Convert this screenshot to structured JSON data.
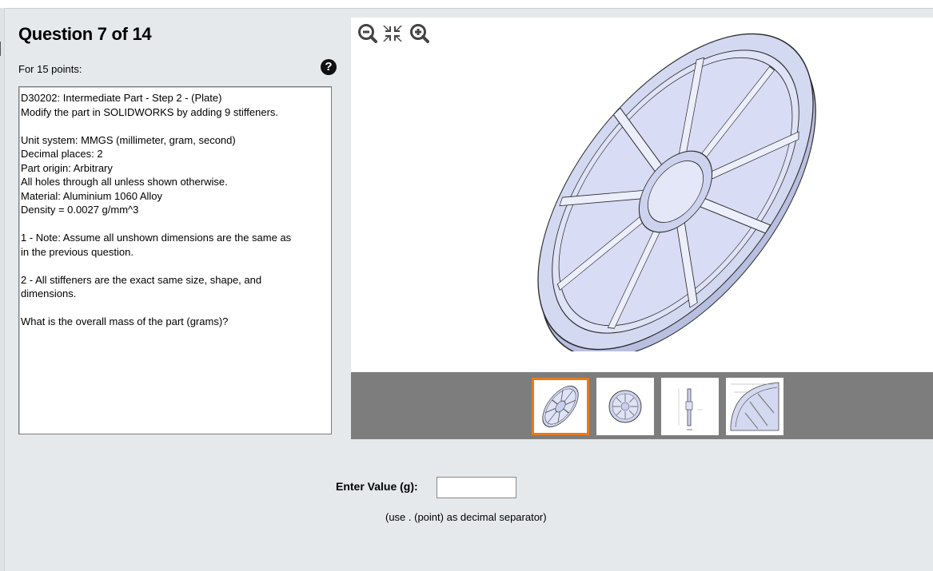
{
  "question": {
    "title": "Question 7 of 14",
    "points": "For 15 points:",
    "help_icon": "question-circle-icon",
    "text_lines": [
      "D30202:  Intermediate Part - Step 2 - (Plate)",
      "Modify the part in SOLIDWORKS by adding 9 stiffeners.",
      "",
      "Unit system: MMGS (millimeter, gram, second)",
      "Decimal places: 2",
      "Part origin: Arbitrary",
      "All holes through all unless shown otherwise.",
      "Material: Aluminium 1060 Alloy",
      "Density = 0.0027 g/mm^3",
      "",
      "1 - Note: Assume all unshown dimensions are the same as",
      "in the previous question.",
      "",
      "2 - All stiffeners are the exact same size, shape, and",
      "dimensions.",
      "",
      "What is the overall mass of the part (grams)?"
    ]
  },
  "viewer": {
    "tools": [
      "zoom-out-icon",
      "fit-screen-icon",
      "zoom-in-icon"
    ],
    "thumbnails": [
      {
        "name": "thumbnail-isometric-view",
        "selected": true
      },
      {
        "name": "thumbnail-front-view",
        "selected": false
      },
      {
        "name": "thumbnail-side-view",
        "selected": false
      },
      {
        "name": "thumbnail-detail-view",
        "selected": false
      }
    ],
    "colors": {
      "part_fill": "#d4d9f2",
      "part_edge": "#2b2b2b",
      "strip": "#7d7d7d",
      "active_border": "#e87b1c"
    }
  },
  "answer": {
    "label": "Enter Value (g):",
    "value": "",
    "hint": "(use . (point) as decimal separator)"
  }
}
